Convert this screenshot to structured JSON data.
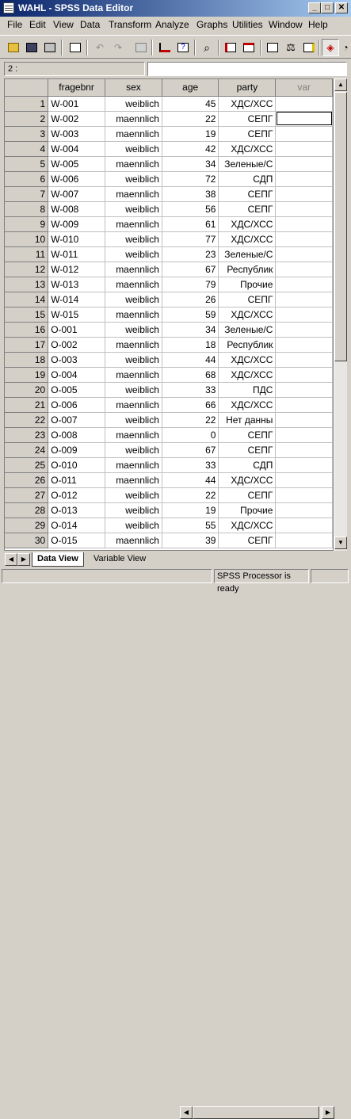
{
  "window": {
    "title": "WAHL - SPSS Data Editor",
    "min": "_",
    "max": "□",
    "close": "✕"
  },
  "menu": [
    "File",
    "Edit",
    "View",
    "Data",
    "Transform",
    "Analyze",
    "Graphs",
    "Utilities",
    "Window",
    "Help"
  ],
  "toolbar": {
    "icons": [
      "open-icon",
      "save-icon",
      "print-icon",
      "dialog-recall-icon",
      "undo-icon",
      "redo-icon",
      "goto-chart-icon",
      "goto-case-icon",
      "variables-icon",
      "find-icon",
      "insert-case-icon",
      "insert-variable-icon",
      "split-file-icon",
      "weight-cases-icon",
      "select-cases-icon",
      "value-labels-icon",
      "use-sets-icon"
    ]
  },
  "cell_editor": {
    "reference": "2 :",
    "value": ""
  },
  "grid": {
    "columns": [
      "fragebnr",
      "sex",
      "age",
      "party",
      "var"
    ],
    "rows": [
      {
        "n": "1",
        "fragebnr": "W-001",
        "sex": "weiblich",
        "age": "45",
        "party": "ХДС/ХСС"
      },
      {
        "n": "2",
        "fragebnr": "W-002",
        "sex": "maennlich",
        "age": "22",
        "party": "СЕПГ"
      },
      {
        "n": "3",
        "fragebnr": "W-003",
        "sex": "maennlich",
        "age": "19",
        "party": "СЕПГ"
      },
      {
        "n": "4",
        "fragebnr": "W-004",
        "sex": "weiblich",
        "age": "42",
        "party": "ХДС/ХСС"
      },
      {
        "n": "5",
        "fragebnr": "W-005",
        "sex": "maennlich",
        "age": "34",
        "party": "Зеленые/С"
      },
      {
        "n": "6",
        "fragebnr": "W-006",
        "sex": "weiblich",
        "age": "72",
        "party": "СДП"
      },
      {
        "n": "7",
        "fragebnr": "W-007",
        "sex": "maennlich",
        "age": "38",
        "party": "СЕПГ"
      },
      {
        "n": "8",
        "fragebnr": "W-008",
        "sex": "weiblich",
        "age": "56",
        "party": "СЕПГ"
      },
      {
        "n": "9",
        "fragebnr": "W-009",
        "sex": "maennlich",
        "age": "61",
        "party": "ХДС/ХСС"
      },
      {
        "n": "10",
        "fragebnr": "W-010",
        "sex": "weiblich",
        "age": "77",
        "party": "ХДС/ХСС"
      },
      {
        "n": "11",
        "fragebnr": "W-011",
        "sex": "weiblich",
        "age": "23",
        "party": "Зеленые/С"
      },
      {
        "n": "12",
        "fragebnr": "W-012",
        "sex": "maennlich",
        "age": "67",
        "party": "Республик"
      },
      {
        "n": "13",
        "fragebnr": "W-013",
        "sex": "maennlich",
        "age": "79",
        "party": "Прочие"
      },
      {
        "n": "14",
        "fragebnr": "W-014",
        "sex": "weiblich",
        "age": "26",
        "party": "СЕПГ"
      },
      {
        "n": "15",
        "fragebnr": "W-015",
        "sex": "maennlich",
        "age": "59",
        "party": "ХДС/ХСС"
      },
      {
        "n": "16",
        "fragebnr": "O-001",
        "sex": "weiblich",
        "age": "34",
        "party": "Зеленые/С"
      },
      {
        "n": "17",
        "fragebnr": "O-002",
        "sex": "maennlich",
        "age": "18",
        "party": "Республик"
      },
      {
        "n": "18",
        "fragebnr": "O-003",
        "sex": "weiblich",
        "age": "44",
        "party": "ХДС/ХСС"
      },
      {
        "n": "19",
        "fragebnr": "O-004",
        "sex": "maennlich",
        "age": "68",
        "party": "ХДС/ХСС"
      },
      {
        "n": "20",
        "fragebnr": "O-005",
        "sex": "weiblich",
        "age": "33",
        "party": "ПДС"
      },
      {
        "n": "21",
        "fragebnr": "O-006",
        "sex": "maennlich",
        "age": "66",
        "party": "ХДС/ХСС"
      },
      {
        "n": "22",
        "fragebnr": "O-007",
        "sex": "weiblich",
        "age": "22",
        "party": "Нет данны"
      },
      {
        "n": "23",
        "fragebnr": "O-008",
        "sex": "maennlich",
        "age": "0",
        "party": "СЕПГ"
      },
      {
        "n": "24",
        "fragebnr": "O-009",
        "sex": "weiblich",
        "age": "67",
        "party": "СЕПГ"
      },
      {
        "n": "25",
        "fragebnr": "O-010",
        "sex": "maennlich",
        "age": "33",
        "party": "СДП"
      },
      {
        "n": "26",
        "fragebnr": "O-011",
        "sex": "maennlich",
        "age": "44",
        "party": "ХДС/ХСС"
      },
      {
        "n": "27",
        "fragebnr": "O-012",
        "sex": "weiblich",
        "age": "22",
        "party": "СЕПГ"
      },
      {
        "n": "28",
        "fragebnr": "O-013",
        "sex": "weiblich",
        "age": "19",
        "party": "Прочие"
      },
      {
        "n": "29",
        "fragebnr": "O-014",
        "sex": "weiblich",
        "age": "55",
        "party": "ХДС/ХСС"
      },
      {
        "n": "30",
        "fragebnr": "O-015",
        "sex": "maennlich",
        "age": "39",
        "party": "СЕПГ"
      }
    ]
  },
  "tabs": {
    "data_view": "Data View",
    "variable_view": "Variable View"
  },
  "status": {
    "processor": "SPSS Processor  is ready"
  },
  "colors": {
    "title_bar": "#0a246a",
    "chrome": "#d4d0c8",
    "grid_bg": "#ffffff"
  }
}
